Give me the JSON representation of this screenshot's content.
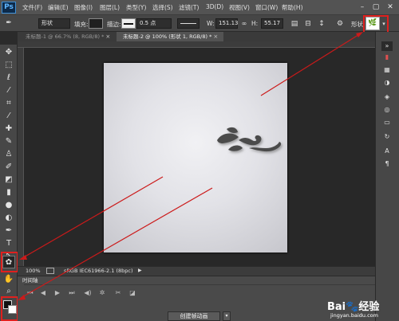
{
  "app": {
    "logo": "Ps"
  },
  "menu": [
    "文件(F)",
    "编辑(E)",
    "图像(I)",
    "图层(L)",
    "类型(Y)",
    "选择(S)",
    "滤镜(T)",
    "3D(D)",
    "视图(V)",
    "窗口(W)",
    "帮助(H)"
  ],
  "window_controls": {
    "minimize": "–",
    "maximize": "▢",
    "close": "✕"
  },
  "options": {
    "mode": "形状",
    "fill_label": "填充:",
    "stroke_label": "描边:",
    "stroke_width": "0.5 点",
    "w_label": "W:",
    "w_value": "151.13",
    "h_label": "H:",
    "h_value": "55.17",
    "shape_label": "形状:",
    "shape_icon": "🌿"
  },
  "tabs": [
    {
      "label": "未标题-1 @ 66.7% (8, RGB/8) *",
      "close": "×",
      "active": false
    },
    {
      "label": "未标题-2 @ 100% (形状 1, RGB/8) *",
      "close": "×",
      "active": true
    }
  ],
  "status": {
    "zoom": "100%",
    "info": "sRGB IEC61966-2.1 (8bpc)",
    "arrow": "▶"
  },
  "timeline": {
    "tab_label": "时间轴",
    "create_button": "创建帧动画",
    "dropdown": "▾"
  },
  "watermark": {
    "main": "Bai🐾经验",
    "url": "jingyan.baidu.com"
  },
  "colors": {
    "highlight": "#e0201e",
    "annotation_line": "#cc1a1a",
    "shape": "#4c4c4c"
  }
}
